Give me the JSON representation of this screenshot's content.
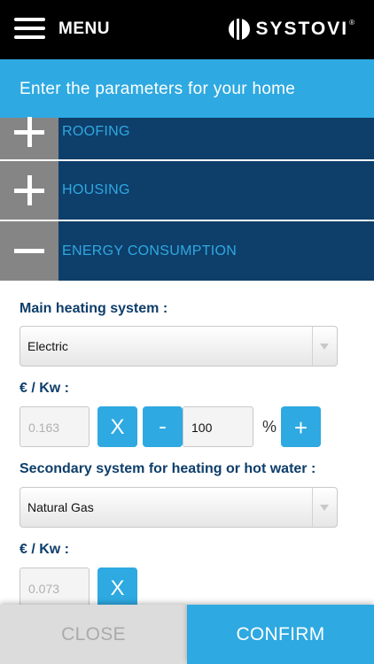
{
  "header": {
    "menu_label": "MENU",
    "brand": "SYSTOVI",
    "brand_mark": "®"
  },
  "subtitle": "Enter the parameters for your home",
  "sections": [
    {
      "label": "ROOFING",
      "state": "collapsed"
    },
    {
      "label": "HOUSING",
      "state": "collapsed"
    },
    {
      "label": "ENERGY CONSUMPTION",
      "state": "expanded"
    }
  ],
  "form": {
    "main_heating_label": "Main heating system :",
    "main_heating_value": "Electric",
    "main_price_label": "€ / Kw :",
    "main_price_value": "0.163",
    "clear_label": "X",
    "minus_label": "-",
    "percent_value": "100",
    "percent_symbol": "%",
    "plus_label": "+",
    "secondary_label": "Secondary system for heating or hot water :",
    "secondary_value": "Natural Gas",
    "secondary_price_label": "€ / Kw :",
    "secondary_price_value": "0.073",
    "secondary_clear_label": "X"
  },
  "footer": {
    "close_label": "CLOSE",
    "confirm_label": "CONFIRM"
  },
  "colors": {
    "accent": "#2ea9e1",
    "navy": "#0e3e6a",
    "toggle_gray": "#858585",
    "header_bg": "#000000"
  }
}
